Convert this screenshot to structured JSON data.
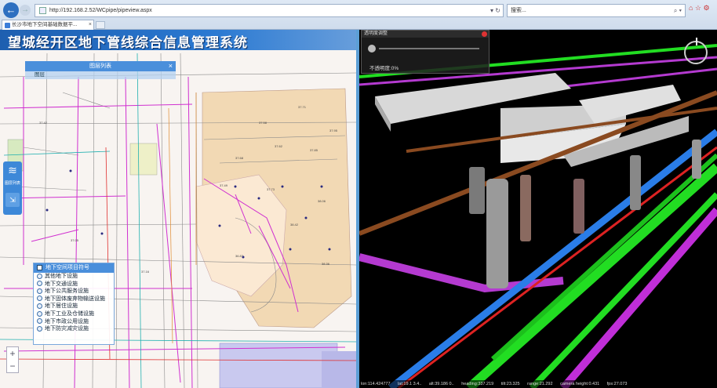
{
  "browser": {
    "url": "http://192.168.2.52/WCpipe/pipeview.aspx",
    "search_placeholder": "搜索...",
    "tab_title": "长沙市地下空间基础数据平..."
  },
  "app": {
    "title": "望城经开区地下管线综合信息管理系统"
  },
  "legend_panel": {
    "header": "图层列表",
    "sub": "图层"
  },
  "sidetools": {
    "layers_label": "图层列表"
  },
  "layer_panel": {
    "header": "地下空间项目符号",
    "items": [
      "其他地下设施",
      "地下交通设施",
      "地下公共服务设施",
      "地下固体废弃物输送设施",
      "地下居住设施",
      "地下工业及仓储设施",
      "地下市政公用设施",
      "地下防灾减灾设施"
    ]
  },
  "zoom": {
    "in": "+",
    "out": "−"
  },
  "viewer": {
    "panel_title": "透明度调整",
    "opacity_label": "不透明度:0%",
    "status": [
      "lon:114.424777",
      "lat:19.1 3.4..",
      "alt:39.186 0..",
      "heading:337.219",
      "tilt:23.325",
      "range:21.292",
      "camera height:0.431",
      "fps:27.073"
    ]
  },
  "colors": {
    "accent": "#2a79d2",
    "pipe_green": "#22dd22",
    "pipe_blue": "#2a7de8",
    "pipe_purple": "#b43ad0",
    "pipe_brown": "#8a4a20",
    "pipe_red": "#dd2222",
    "parcel_fill": "#f4dcb8"
  }
}
